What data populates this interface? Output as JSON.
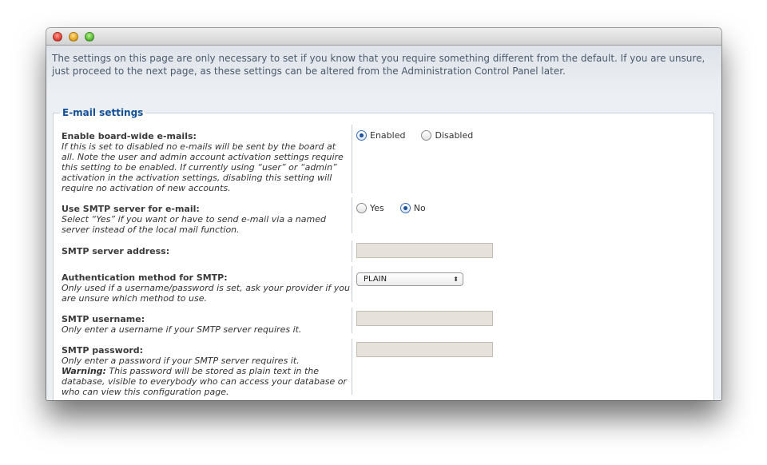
{
  "intro": "The settings on this page are only necessary to set if you know that you require something different from the default. If you are unsure, just proceed to the next page, as these settings can be altered from the Administration Control Panel later.",
  "fieldset": {
    "legend": "E-mail settings"
  },
  "fields": {
    "board_emails": {
      "title": "Enable board-wide e-mails:",
      "desc": "If this is set to disabled no e-mails will be sent by the board at all. Note the user and admin account activation settings require this setting to be enabled. If currently using “user” or “admin” activation in the activation settings, disabling this setting will require no activation of new accounts.",
      "options": [
        "Enabled",
        "Disabled"
      ],
      "selected": "Enabled"
    },
    "smtp": {
      "title": "Use SMTP server for e-mail:",
      "desc": "Select “Yes” if you want or have to send e-mail via a named server instead of the local mail function.",
      "options": [
        "Yes",
        "No"
      ],
      "selected": "No"
    },
    "smtp_host": {
      "title": "SMTP server address:",
      "value": ""
    },
    "smtp_auth": {
      "title": "Authentication method for SMTP:",
      "desc": "Only used if a username/password is set, ask your provider if you are unsure which method to use.",
      "value": "PLAIN"
    },
    "smtp_user": {
      "title": "SMTP username:",
      "desc": "Only enter a username if your SMTP server requires it.",
      "value": ""
    },
    "smtp_pass": {
      "title": "SMTP password:",
      "desc": "Only enter a password if your SMTP server requires it.",
      "warning_label": "Warning:",
      "warning": "This password will be stored as plain text in the database, visible to everybody who can access your database or who can view this configuration page.",
      "value": ""
    }
  },
  "colors": {
    "legend": "#115098",
    "intro_text": "#4a5a6c",
    "input_bg": "#e6e1da"
  }
}
